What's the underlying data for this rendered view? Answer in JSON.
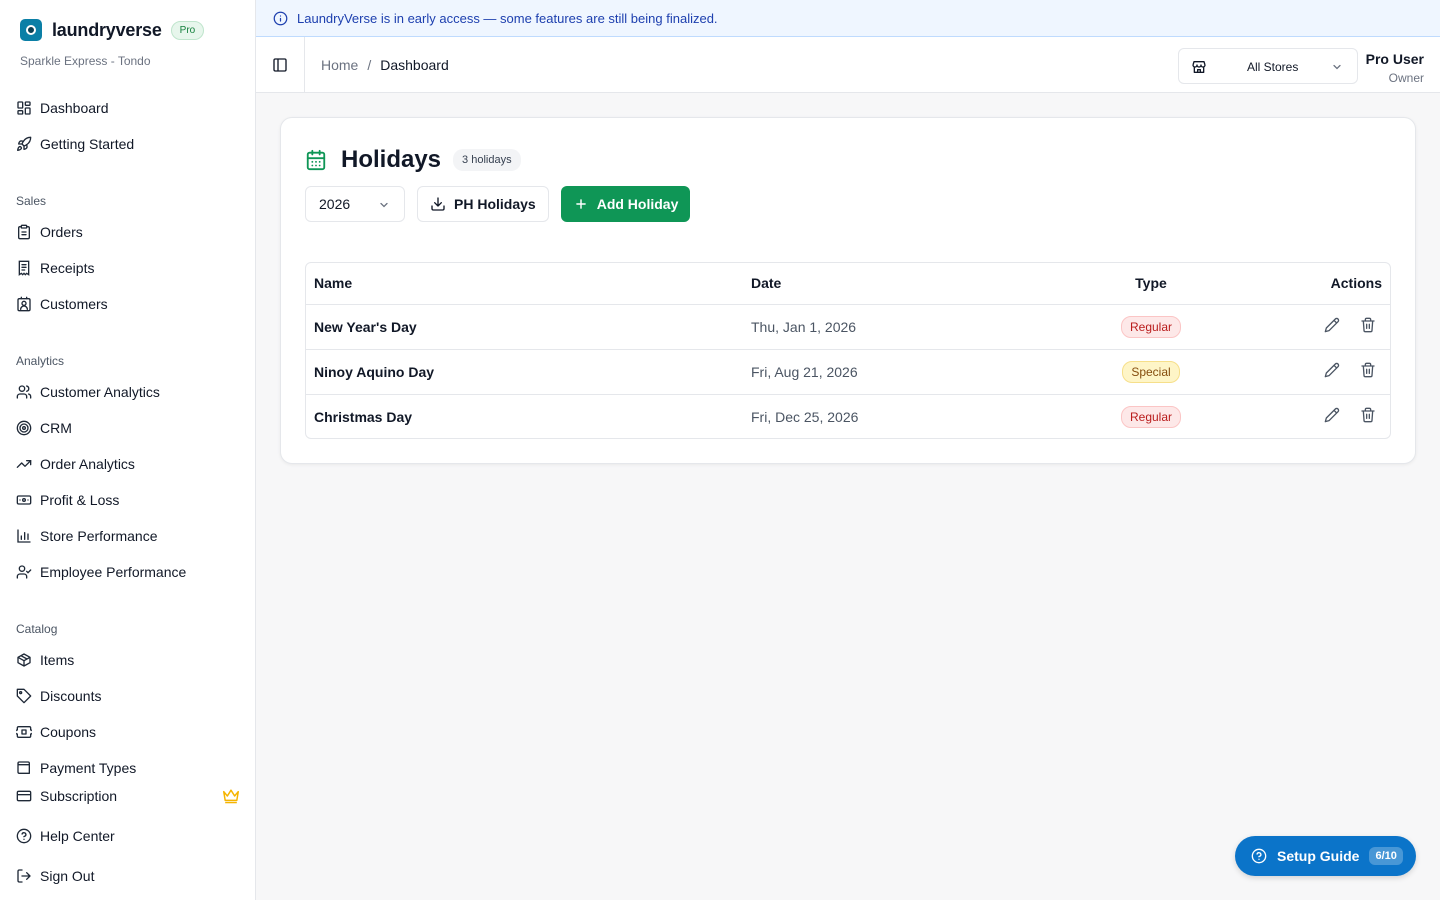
{
  "brand": {
    "name": "laundryverse",
    "badge": "Pro",
    "store": "Sparkle Express - Tondo",
    "logo_color": "#0b7fa6"
  },
  "banner": {
    "text": "LaundryVerse is in early access — some features are still being finalized."
  },
  "breadcrumb": {
    "home": "Home",
    "separator": "/",
    "current": "Dashboard"
  },
  "store_select": {
    "value": "All Stores"
  },
  "user": {
    "name": "Pro User",
    "role": "Owner"
  },
  "sidebar": {
    "top": [
      {
        "label": "Dashboard",
        "icon": "dashboard-icon"
      },
      {
        "label": "Getting Started",
        "icon": "rocket-icon"
      }
    ],
    "sales_label": "Sales",
    "sales": [
      {
        "label": "Orders",
        "icon": "clipboard-icon"
      },
      {
        "label": "Receipts",
        "icon": "receipt-icon"
      },
      {
        "label": "Customers",
        "icon": "contact-icon"
      }
    ],
    "analytics_label": "Analytics",
    "analytics": [
      {
        "label": "Customer Analytics",
        "icon": "users-icon"
      },
      {
        "label": "CRM",
        "icon": "target-icon"
      },
      {
        "label": "Order Analytics",
        "icon": "trending-up-icon"
      },
      {
        "label": "Profit & Loss",
        "icon": "banknote-icon"
      },
      {
        "label": "Store Performance",
        "icon": "bar-chart-icon"
      },
      {
        "label": "Employee Performance",
        "icon": "user-check-icon"
      }
    ],
    "catalog_label": "Catalog",
    "catalog": [
      {
        "label": "Items",
        "icon": "package-icon"
      },
      {
        "label": "Discounts",
        "icon": "tag-icon"
      },
      {
        "label": "Coupons",
        "icon": "ticket-icon"
      },
      {
        "label": "Payment Types",
        "icon": "wallet-icon"
      }
    ],
    "bottom": [
      {
        "label": "Subscription",
        "icon": "credit-card-icon"
      },
      {
        "label": "Help Center",
        "icon": "help-circle-icon"
      },
      {
        "label": "Sign Out",
        "icon": "log-out-icon"
      }
    ]
  },
  "holidays": {
    "title": "Holidays",
    "count": "3 holidays",
    "year": "2026",
    "ph_button": "PH Holidays",
    "add_button": "Add Holiday",
    "columns": {
      "name": "Name",
      "date": "Date",
      "type": "Type",
      "actions": "Actions"
    },
    "rows": [
      {
        "name": "New Year's Day",
        "date": "Thu, Jan 1, 2026",
        "type": "Regular"
      },
      {
        "name": "Ninoy Aquino Day",
        "date": "Fri, Aug 21, 2026",
        "type": "Special"
      },
      {
        "name": "Christmas Day",
        "date": "Fri, Dec 25, 2026",
        "type": "Regular"
      }
    ]
  },
  "setup_guide": {
    "label": "Setup Guide",
    "progress": "6/10"
  },
  "colors": {
    "primary": "#0f9656",
    "banner_text": "#1e40af",
    "setup_guide": "#0b74c9",
    "crown": "#f5b400"
  }
}
